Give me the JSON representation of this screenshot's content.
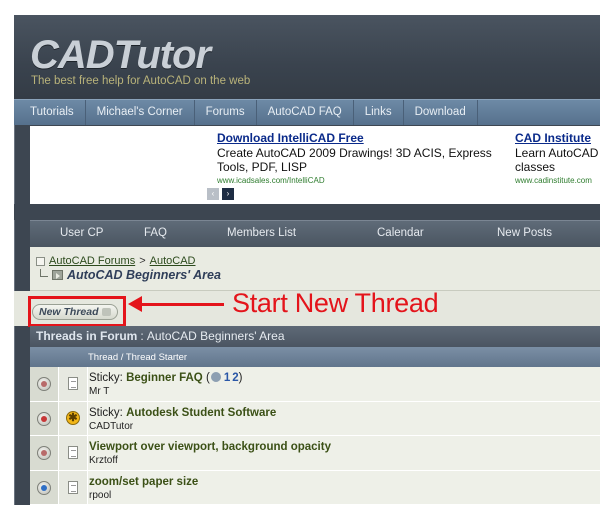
{
  "header": {
    "logo": "CADTutor",
    "tagline": "The best free help for AutoCAD on the web"
  },
  "nav": {
    "items": [
      "Tutorials",
      "Michael's Corner",
      "Forums",
      "AutoCAD FAQ",
      "Links",
      "Download"
    ]
  },
  "ads": [
    {
      "title": "Download IntelliCAD Free",
      "text": "Create AutoCAD 2009 Drawings! 3D ACIS, Express Tools, PDF, LISP",
      "url": "www.icadsales.com/IntelliCAD"
    },
    {
      "title": "CAD Institute",
      "text": "Learn AutoCAD classes",
      "url": "www.cadinstitute.com"
    }
  ],
  "ad_nav": {
    "prev": "‹",
    "next": "›"
  },
  "toolbar": {
    "items": [
      "User CP",
      "FAQ",
      "Members List",
      "Calendar",
      "New Posts"
    ]
  },
  "breadcrumb": {
    "forums": "AutoCAD Forums",
    "sep": ">",
    "parent": "AutoCAD",
    "current": "AutoCAD Beginners' Area"
  },
  "new_thread": {
    "label": "New Thread"
  },
  "annotation": {
    "text": "Start New Thread"
  },
  "threads_header": {
    "label": "Threads in Forum",
    "sep": ":",
    "forum": "AutoCAD Beginners' Area",
    "column": "Thread / Thread Starter"
  },
  "colors": {
    "annotation": "#e4141b",
    "thread_title": "#3b5016",
    "link": "#2c4a1c"
  },
  "threads": [
    {
      "prefix": "Sticky:",
      "title": "Beginner FAQ",
      "pages": [
        "1",
        "2"
      ],
      "starter": "Mr T",
      "status_icon": "status-icon",
      "type_icon": "document-icon"
    },
    {
      "prefix": "Sticky:",
      "title": "Autodesk Student Software",
      "starter": "CADTutor",
      "status_icon": "status-locked-icon",
      "type_icon": "star-icon"
    },
    {
      "prefix": "",
      "title": "Viewport over viewport, background opacity",
      "starter": "Krztoff",
      "status_icon": "status-icon",
      "type_icon": "document-icon"
    },
    {
      "prefix": "",
      "title": "zoom/set paper size",
      "starter": "rpool",
      "status_icon": "status-new-icon",
      "type_icon": "document-icon"
    }
  ]
}
